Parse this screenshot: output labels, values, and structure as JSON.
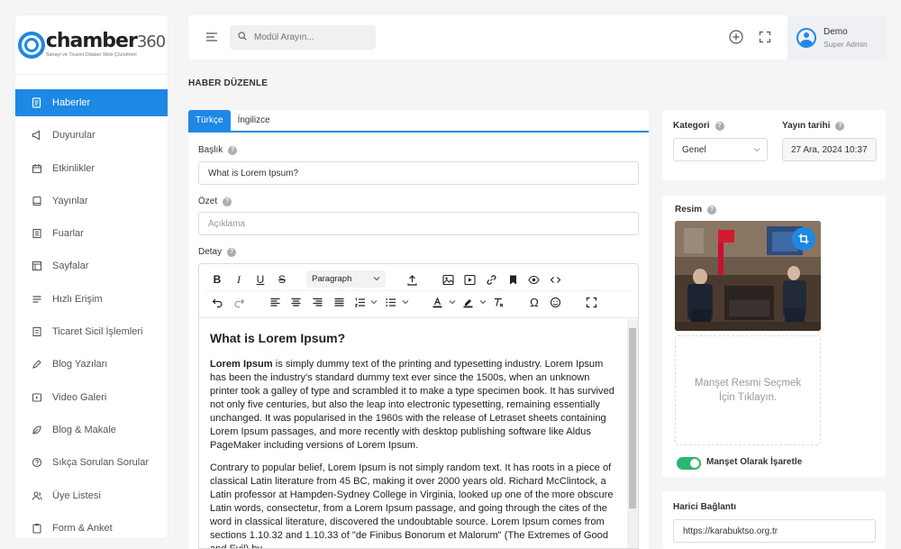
{
  "logo": {
    "word": "chamber",
    "num": "360",
    "tagline": "Sanayi ve Ticaret Odaları Web Çözümleri"
  },
  "sidebar": {
    "items": [
      {
        "label": "Haberler",
        "icon": "news-icon",
        "active": true
      },
      {
        "label": "Duyurular",
        "icon": "megaphone-icon"
      },
      {
        "label": "Etkinlikler",
        "icon": "calendar-icon"
      },
      {
        "label": "Yayınlar",
        "icon": "book-icon"
      },
      {
        "label": "Fuarlar",
        "icon": "document-icon"
      },
      {
        "label": "Sayfalar",
        "icon": "pages-icon"
      },
      {
        "label": "Hızlı Erişim",
        "icon": "lines-icon"
      },
      {
        "label": "Ticaret Sicil İşlemleri",
        "icon": "register-icon"
      },
      {
        "label": "Blog Yazıları",
        "icon": "pen-icon"
      },
      {
        "label": "Video Galeri",
        "icon": "video-icon"
      },
      {
        "label": "Blog & Makale",
        "icon": "leaf-icon"
      },
      {
        "label": "Sıkça Sorulan Sorular",
        "icon": "question-icon"
      },
      {
        "label": "Üye Listesi",
        "icon": "users-icon"
      },
      {
        "label": "Form & Anket",
        "icon": "clipboard-icon"
      }
    ]
  },
  "topbar": {
    "search_placeholder": "Modül Arayın...",
    "user_name": "Demo",
    "user_role": "Super Admin"
  },
  "page": {
    "title": "HABER DÜZENLE"
  },
  "tabs": [
    {
      "label": "Türkçe",
      "active": true
    },
    {
      "label": "İngilizce"
    }
  ],
  "form": {
    "title_label": "Başlık",
    "title_value": "What is Lorem Ipsum?",
    "summary_label": "Özet",
    "summary_placeholder": "Açıklama",
    "detail_label": "Detay",
    "help": "?"
  },
  "editor": {
    "paragraph_style": "Paragraph",
    "heading": "What is Lorem Ipsum?",
    "p1_bold": "Lorem Ipsum",
    "p1_rest": " is simply dummy text of the printing and typesetting industry. Lorem Ipsum has been the industry's standard dummy text ever since the 1500s, when an unknown printer took a galley of type and scrambled it to make a type specimen book. It has survived not only five centuries, but also the leap into electronic typesetting, remaining essentially unchanged. It was popularised in the 1960s with the release of Letraset sheets containing Lorem Ipsum passages, and more recently with desktop publishing software like Aldus PageMaker including versions of Lorem Ipsum.",
    "p2": "Contrary to popular belief, Lorem Ipsum is not simply random text. It has roots in a piece of classical Latin literature from 45 BC, making it over 2000 years old. Richard McClintock, a Latin professor at Hampden-Sydney College in Virginia, looked up one of the more obscure Latin words, consectetur, from a Lorem Ipsum passage, and going through the cites of the word in classical literature, discovered the undoubtable source. Lorem Ipsum comes from sections 1.10.32 and 1.10.33 of \"de Finibus Bonorum et Malorum\" (The Extremes of Good and Evil) by"
  },
  "right": {
    "category_label": "Kategori",
    "category_value": "Genel",
    "date_label": "Yayın tarihi",
    "date_value": "27 Ara, 2024 10:37",
    "image_label": "Resim",
    "upload_text": "Manşet Resmi Seçmek İçin Tıklayın.",
    "headline_toggle_label": "Manşet Olarak İşaretle",
    "headline_toggle_on": true,
    "external_link_label": "Harici Bağlantı",
    "external_link_value": "https://karabuktso.org.tr"
  },
  "colors": {
    "accent": "#1e88e5",
    "toggle": "#2bb673"
  }
}
